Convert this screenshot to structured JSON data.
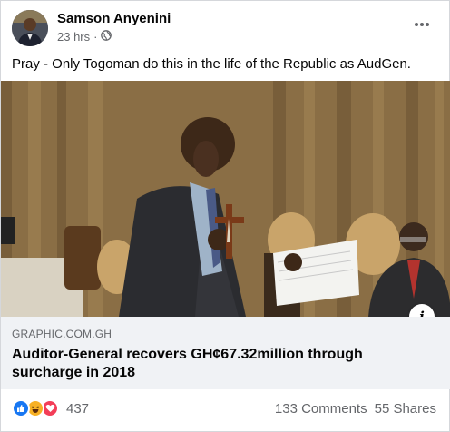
{
  "post": {
    "author": "Samson Anyenini",
    "time": "23 hrs",
    "privacy_icon": "globe-icon",
    "caption": "Pray - Only Togoman do this in the life of the Republic as AudGen."
  },
  "link_preview": {
    "domain": "GRAPHIC.COM.GH",
    "title": "Auditor-General recovers GH¢67.32million through surcharge in 2018"
  },
  "engagement": {
    "reaction_icons": [
      "like-icon",
      "haha-icon",
      "love-icon"
    ],
    "reaction_count": "437",
    "comments": "133 Comments",
    "shares": "55 Shares"
  },
  "colors": {
    "like": "#1877f2",
    "haha": "#f7b125",
    "love": "#f33e58",
    "secondary_text": "#65676b",
    "link_bg": "#f0f2f5"
  }
}
